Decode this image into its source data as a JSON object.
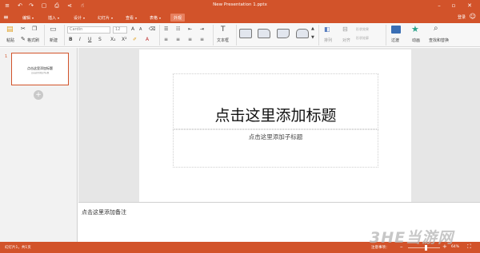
{
  "window": {
    "title": "New Presentation 1.pptx"
  },
  "menu": {
    "items": [
      {
        "label": "编辑"
      },
      {
        "label": "插入"
      },
      {
        "label": "设计"
      },
      {
        "label": "幻灯片"
      },
      {
        "label": "查看"
      },
      {
        "label": "表格"
      },
      {
        "label": "外观"
      }
    ],
    "active_index": 6,
    "login_label": "登录"
  },
  "ribbon": {
    "paste_label": "粘贴",
    "format_painter_label": "格式刷",
    "new_slide_label": "新建",
    "font_name": "Cardin",
    "font_size": "12",
    "textbox_label": "文本框",
    "arrange_label": "排列",
    "align_label": "对齐",
    "shape_effects_label": "形状效果",
    "shape_outline_label": "形状轮廓",
    "transition_label": "过渡",
    "animation_label": "动画",
    "find_replace_label": "查找和替换"
  },
  "slides_panel": {
    "slide_number": "1",
    "thumb_title": "点击这里添加标题",
    "thumb_subtitle": "点击这里添加子标题"
  },
  "slide": {
    "title_placeholder": "点击这里添加标题",
    "subtitle_placeholder": "点击这里添加子标题"
  },
  "notes": {
    "placeholder": "点击这里添加备注"
  },
  "status": {
    "slide_info": "幻灯片1，共1页",
    "notes_label": "注意事项：",
    "zoom": "64%",
    "zoom_level": 0.64
  },
  "watermark": {
    "text": "3HE当游网"
  },
  "colors": {
    "accent": "#d2532a"
  }
}
